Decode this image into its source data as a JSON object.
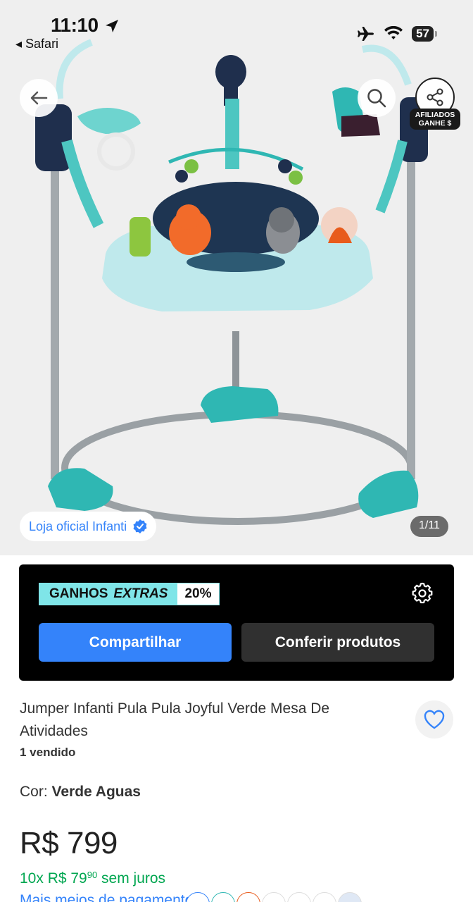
{
  "status_bar": {
    "time": "11:10",
    "back_app": "◂ Safari",
    "battery": "57"
  },
  "hero": {
    "store_label": "Loja oficial Infanti",
    "image_counter": "1/11",
    "affiliate_tag_line1": "AFILIADOS",
    "affiliate_tag_line2": "GANHE $",
    "icons": [
      "back-arrow-icon",
      "search-icon",
      "share-icon",
      "verified-icon"
    ]
  },
  "promo": {
    "gains_label": "GANHOS",
    "gains_extra": "EXTRAS",
    "gains_percent": "20%",
    "share_button": "Compartilhar",
    "check_button": "Conferir produtos"
  },
  "product": {
    "title": "Jumper Infanti Pula Pula Joyful Verde Mesa De Atividades",
    "sold": "1 vendido",
    "color_label": "Cor: ",
    "color_value": "Verde Aguas",
    "price": "R$ 799",
    "installments_prefix": "10x R$ 79",
    "installments_cents": "90",
    "installments_suffix": " sem juros",
    "more_payment_methods": "Mais meios de pagamento"
  },
  "colors": {
    "accent_blue": "#3483fa",
    "green": "#00a650",
    "teal": "#7fe5e8"
  }
}
